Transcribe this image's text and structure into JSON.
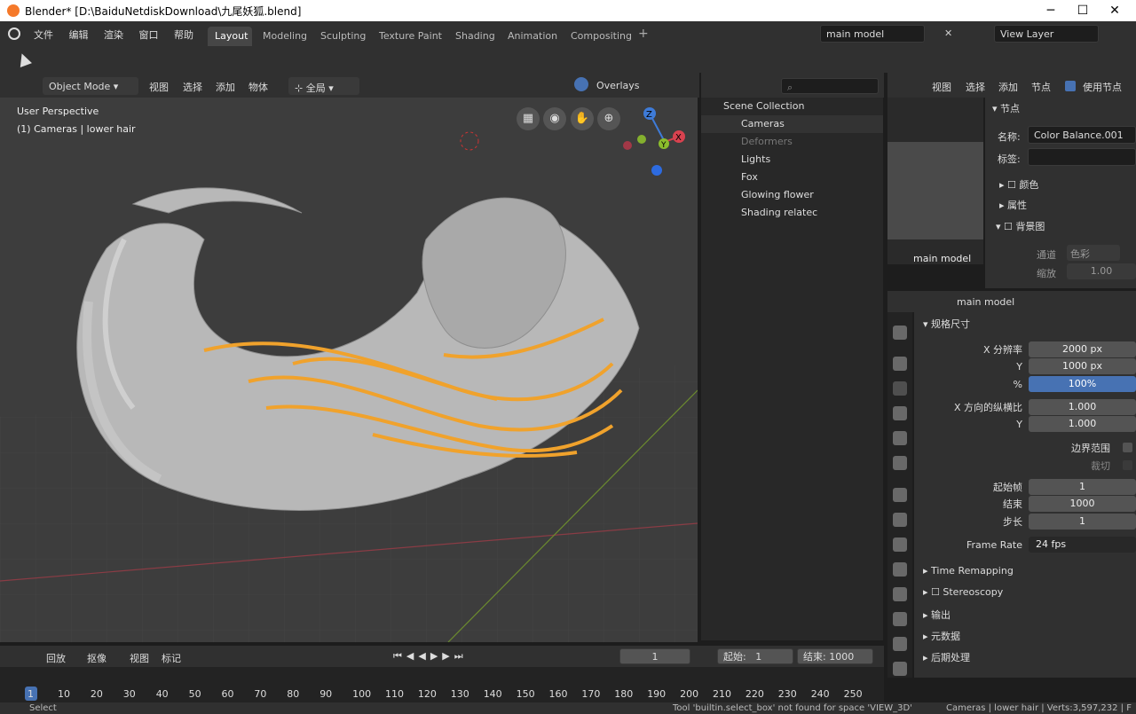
{
  "app": {
    "title": "Blender* [D:\\BaiduNetdiskDownload\\九尾妖狐.blend]"
  },
  "menu": [
    "文件",
    "编辑",
    "渲染",
    "窗口",
    "帮助"
  ],
  "workspaces": [
    "Layout",
    "Modeling",
    "Sculpting",
    "Texture Paint",
    "Shading",
    "Animation",
    "Compositing"
  ],
  "scene": {
    "name": "main model",
    "view_layer": "View Layer"
  },
  "viewport": {
    "mode": "Object Mode",
    "menus": [
      "视图",
      "选择",
      "添加",
      "物体"
    ],
    "transform": "全局",
    "overlays": "Overlays",
    "info1": "User Perspective",
    "info2": "(1) Cameras | lower hair",
    "gizmo": {
      "x": "X",
      "y": "Y",
      "z": "Z"
    }
  },
  "outliner": {
    "root": "Scene Collection",
    "items": [
      "Cameras",
      "Deformers",
      "Lights",
      "Fox",
      "Glowing flower",
      "Shading relatec"
    ]
  },
  "node_editor": {
    "menus": [
      "视图",
      "选择",
      "添加",
      "节点"
    ],
    "use_nodes": "使用节点",
    "preview_label": "main model",
    "panel_title": "节点",
    "name_label": "名称:",
    "name_value": "Color Balance.001",
    "tag_label": "标签:",
    "color_label": "颜色",
    "attr_label": "属性",
    "bg_label": "背景图",
    "channel_label": "通道",
    "channel_value": "色彩",
    "scale_label": "缩放",
    "scale_value": "1.00"
  },
  "properties": {
    "scene_name": "main model",
    "section": "规格尺寸",
    "rows": [
      {
        "label": "X 分辨率",
        "value": "2000 px"
      },
      {
        "label": "Y",
        "value": "1000 px"
      },
      {
        "label": "%",
        "value": "100%"
      },
      {
        "label": "X 方向的纵横比",
        "value": "1.000"
      },
      {
        "label": "Y",
        "value": "1.000"
      }
    ],
    "border": "边界范围",
    "crop": "裁切",
    "frame_start_label": "起始帧",
    "frame_start": "1",
    "end_label": "结束",
    "end": "1000",
    "step_label": "步长",
    "step": "1",
    "frame_rate_label": "Frame Rate",
    "frame_rate": "24 fps",
    "sections": [
      "Time Remapping",
      "Stereoscopy",
      "输出",
      "元数据",
      "后期处理"
    ]
  },
  "timeline": {
    "menus": [
      "回放",
      "抠像",
      "视图",
      "标记"
    ],
    "current": "1",
    "start_label": "起始:",
    "start": "1",
    "end_label": "结束:",
    "end": "1000",
    "ticks": [
      "1",
      "10",
      "20",
      "30",
      "40",
      "50",
      "60",
      "70",
      "80",
      "90",
      "100",
      "110",
      "120",
      "130",
      "140",
      "150",
      "160",
      "170",
      "180",
      "190",
      "200",
      "210",
      "220",
      "230",
      "240",
      "250"
    ]
  },
  "status": {
    "left": "Select",
    "warning": "Tool 'builtin.select_box' not found for space 'VIEW_3D'",
    "right": "Cameras | lower hair | Verts:3,597,232 | F"
  }
}
